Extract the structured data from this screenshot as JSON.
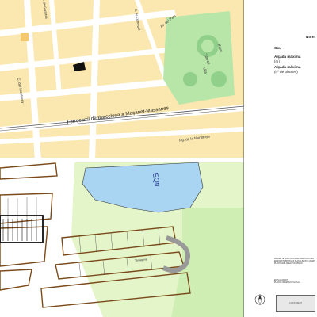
{
  "map": {
    "labels": {
      "av_parc": "Av. del Parc",
      "parc": "Parc",
      "torres": "Torres",
      "vila": "Vila",
      "c_garrotxa": "C. de Garrotxa",
      "c_montseny": "C. del Montseny",
      "c_llobregat": "C. de Llobregat",
      "ferrocarril": "Ferrocarril de Barcelona a Maçanet-Massanes",
      "pg_muntanya": "Pg. de la Muntanya",
      "water_label": "EQtr",
      "parc_label": "Parc",
      "tarragona_lbl": "Tarragona"
    },
    "colors": {
      "urban_block": "#fbe8b0",
      "road": "#ffffff",
      "park": "#b8e6a8",
      "park_dark": "#90d08a",
      "water": "#a9d4f2",
      "building_black": "#111111",
      "parcel_outline": "#7a4a1a",
      "light_green": "#e4f5c9"
    }
  },
  "legend": {
    "header": "Norm",
    "rows": [
      {
        "label": "Ocu",
        "sub": ""
      },
      {
        "label": "Alçada màxima",
        "sub": "(m)"
      },
      {
        "label": "Alçada màxima",
        "sub": "(nº de plantes)"
      }
    ]
  },
  "title_block": {
    "description": "PROJECTE BASIC DE LA REHABILITACIO DEL EDIFICI D'HABITATGES PLANTA BAIXA I QUART PLANTA AMB ÀREA D'OCUPACIÓ",
    "subject": "EMPLAÇAMENT",
    "plan_ref": "PLANOL ORDENACIO ACTUAL",
    "logo_text": "AJUNTAMENT"
  }
}
